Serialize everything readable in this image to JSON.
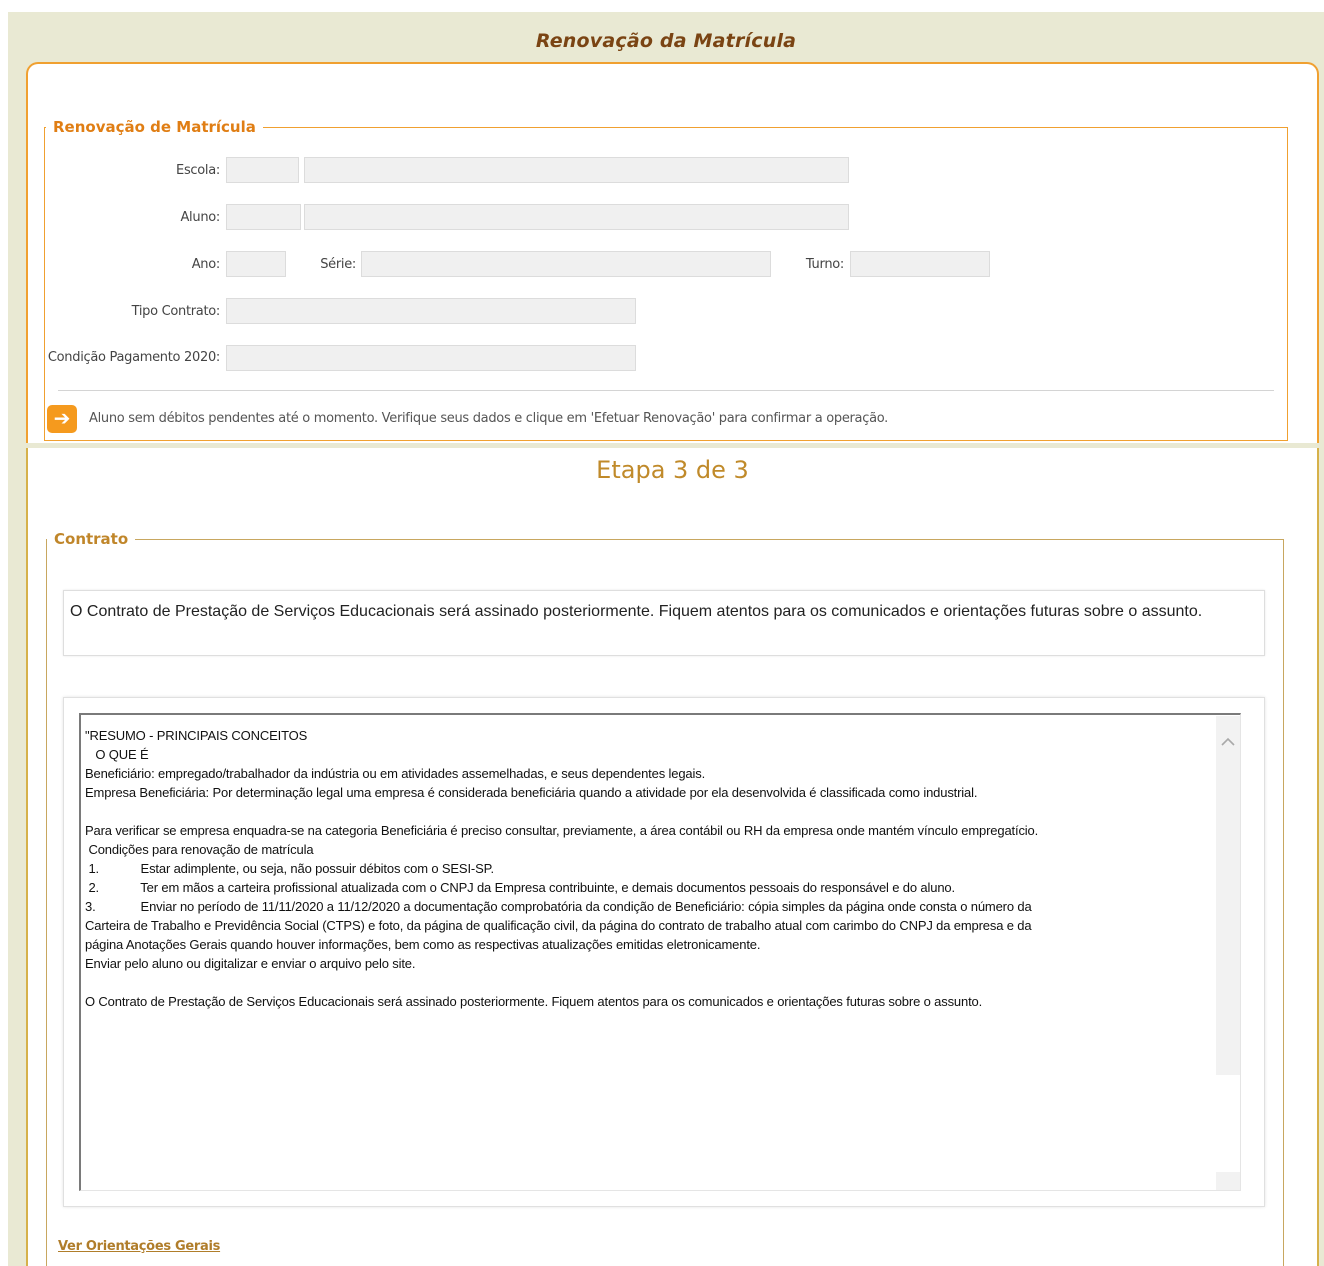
{
  "page": {
    "title": "Renovação da Matrícula"
  },
  "matricula": {
    "legend": "Renovação de Matrícula",
    "labels": {
      "escola": "Escola:",
      "aluno": "Aluno:",
      "ano": "Ano:",
      "serie": "Série:",
      "turno": "Turno:",
      "tipo_contrato": "Tipo Contrato:",
      "condicao_pagamento": "Condição Pagamento 2020:"
    },
    "info_icon": "arrow-right-icon",
    "info_message": "Aluno sem débitos pendentes até o momento. Verifique seus dados e clique em 'Efetuar Renovação' para confirmar a operação."
  },
  "etapa": "Etapa 3 de 3",
  "contrato": {
    "legend": "Contrato",
    "notice": "O Contrato de Prestação de Serviços Educacionais será assinado posteriormente. Fiquem atentos para os comunicados e orientações futuras sobre o assunto.",
    "terms_lines": [
      "\"RESUMO - PRINCIPAIS CONCEITOS",
      "   O QUE É",
      "Beneficiário: empregado/trabalhador da indústria ou em atividades assemelhadas, e seus dependentes legais.",
      "Empresa Beneficiária: Por determinação legal uma empresa é considerada beneficiária quando a atividade por ela desenvolvida é classificada como industrial.",
      "",
      "Para verificar se empresa enquadra-se na categoria Beneficiária é preciso consultar, previamente, a área contábil ou RH da empresa onde mantém vínculo empregatício.",
      " Condições para renovação de matrícula",
      " 1.            Estar adimplente, ou seja, não possuir débitos com o SESI-SP.",
      " 2.            Ter em mãos a carteira profissional atualizada com o CNPJ da Empresa contribuinte, e demais documentos pessoais do responsável e do aluno.",
      "3.             Enviar no período de 11/11/2020 a 11/12/2020 a documentação comprobatória da condição de Beneficiário: cópia simples da página onde consta o número da",
      "Carteira de Trabalho e Previdência Social (CTPS) e foto, da página de qualificação civil, da página do contrato de trabalho atual com carimbo do CNPJ da empresa e da",
      "página Anotações Gerais quando houver informações, bem como as respectivas atualizações emitidas eletronicamente.",
      "Enviar pelo aluno ou digitalizar e enviar o arquivo pelo site.",
      "",
      "O Contrato de Prestação de Serviços Educacionais será assinado posteriormente. Fiquem atentos para os comunicados e orientações futuras sobre o assunto."
    ],
    "scroll_icon": "chevron-up-icon",
    "orientacoes_link": "Ver Orientações Gerais"
  }
}
